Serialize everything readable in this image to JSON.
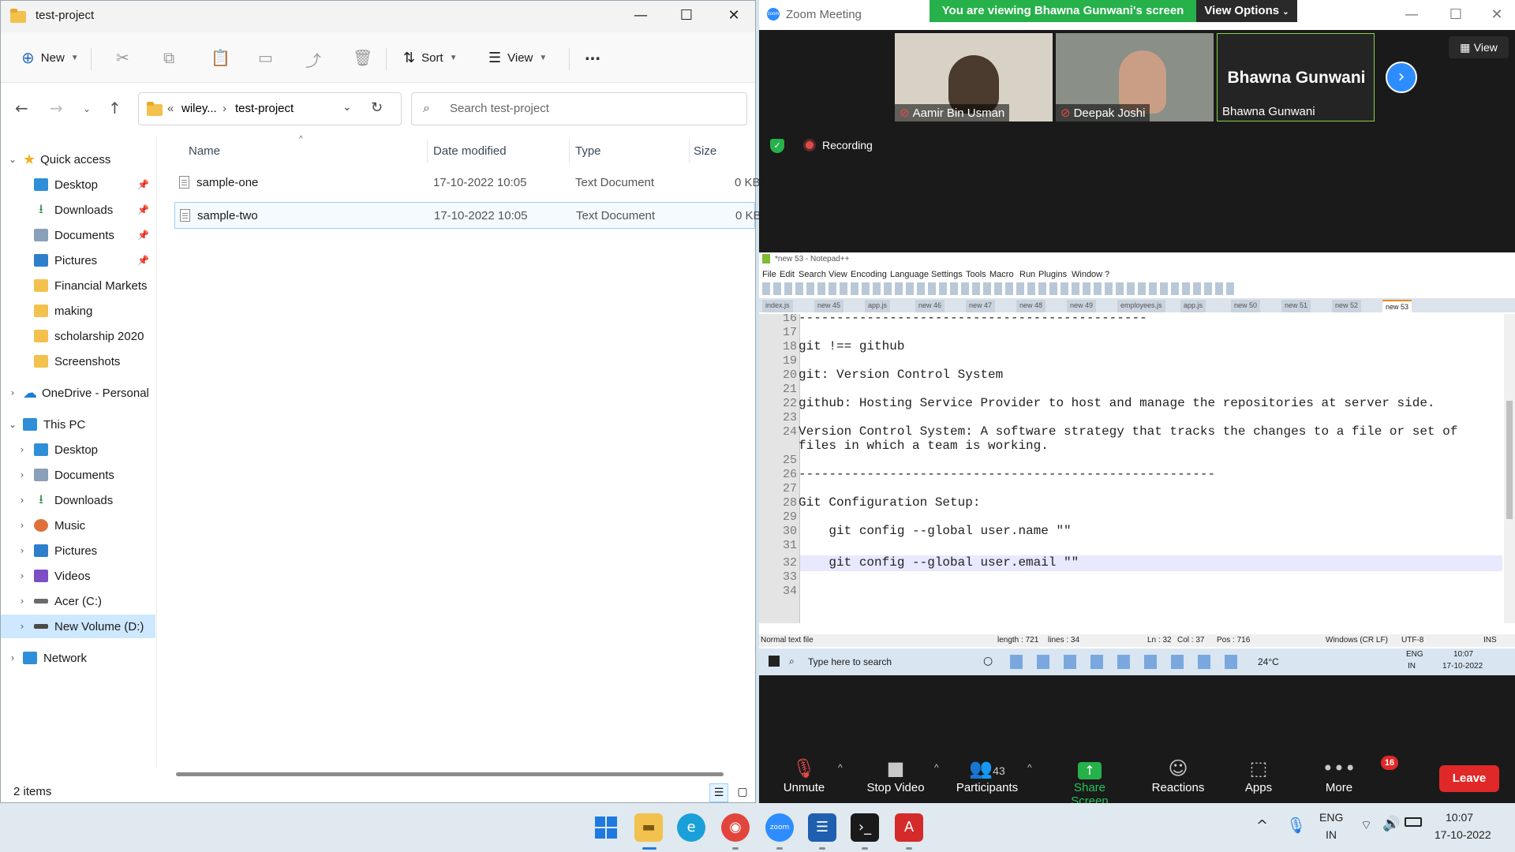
{
  "explorer": {
    "title": "test-project",
    "toolbar": {
      "new": "New",
      "sort": "Sort",
      "view": "View",
      "more": "..."
    },
    "address": {
      "prefix": "«",
      "parent": "wiley...",
      "sep": "›",
      "current": "test-project"
    },
    "search_placeholder": "Search test-project",
    "nav": {
      "quick_access": "Quick access",
      "quick_items": [
        "Desktop",
        "Downloads",
        "Documents",
        "Pictures",
        "Financial Markets",
        "making",
        "scholarship 2020",
        "Screenshots"
      ],
      "onedrive": "OneDrive - Personal",
      "this_pc": "This PC",
      "pc_items": [
        "Desktop",
        "Documents",
        "Downloads",
        "Music",
        "Pictures",
        "Videos",
        "Acer (C:)",
        "New Volume (D:)"
      ],
      "network": "Network"
    },
    "columns": {
      "name": "Name",
      "date": "Date modified",
      "type": "Type",
      "size": "Size"
    },
    "files": [
      {
        "name": "sample-one",
        "date": "17-10-2022 10:05",
        "type": "Text Document",
        "size": "0 KB"
      },
      {
        "name": "sample-two",
        "date": "17-10-2022 10:05",
        "type": "Text Document",
        "size": "0 KB"
      }
    ],
    "status": "2 items"
  },
  "zoom": {
    "title": "Zoom Meeting",
    "banner": "You are viewing Bhawna Gunwani's screen",
    "view_options": "View Options",
    "view_btn": "View",
    "participants": [
      {
        "name": "Aamir Bin Usman"
      },
      {
        "name": "Deepak Joshi"
      },
      {
        "name": "Bhawna Gunwani",
        "big": "Bhawna Gunwani"
      }
    ],
    "recording": "Recording",
    "controls": {
      "unmute": "Unmute",
      "stop_video": "Stop Video",
      "participants": "Participants",
      "participants_count": "43",
      "share": "Share Screen",
      "reactions": "Reactions",
      "apps": "Apps",
      "more": "More",
      "more_badge": "16",
      "leave": "Leave"
    }
  },
  "notepad": {
    "title": "*new 53 - Notepad++",
    "menu": [
      "File",
      "Edit",
      "Search",
      "View",
      "Encoding",
      "Language",
      "Settings",
      "Tools",
      "Macro",
      "Run",
      "Plugins",
      "Window",
      "?"
    ],
    "tabs": [
      "index.js",
      "new 45",
      "app.js",
      "new 46",
      "new 47",
      "new 48",
      "new 49",
      "employees.js",
      "app.js",
      "new 50",
      "new 51",
      "new 52",
      "new 53"
    ],
    "lines": [
      {
        "n": "16",
        "text": "----------------------------------------------"
      },
      {
        "n": "17",
        "text": ""
      },
      {
        "n": "18",
        "text": "git !== github"
      },
      {
        "n": "19",
        "text": ""
      },
      {
        "n": "20",
        "text": "git: Version Control System"
      },
      {
        "n": "21",
        "text": ""
      },
      {
        "n": "22",
        "text": "github: Hosting Service Provider to host and manage the repositories at server side."
      },
      {
        "n": "23",
        "text": ""
      },
      {
        "n": "24",
        "text": "Version Control System: A software strategy that tracks the changes to a file or set of"
      },
      {
        "n": "",
        "text": "files in which a team is working."
      },
      {
        "n": "25",
        "text": ""
      },
      {
        "n": "26",
        "text": "-------------------------------------------------------"
      },
      {
        "n": "27",
        "text": ""
      },
      {
        "n": "28",
        "text": "Git Configuration Setup:"
      },
      {
        "n": "29",
        "text": ""
      },
      {
        "n": "30",
        "text": "    git config --global user.name \"\""
      },
      {
        "n": "31",
        "text": ""
      },
      {
        "n": "32",
        "text": "    git config --global user.email \"\""
      },
      {
        "n": "33",
        "text": ""
      },
      {
        "n": "34",
        "text": ""
      }
    ],
    "status": {
      "filetype": "Normal text file",
      "length": "length : 721",
      "lines": "lines : 34",
      "ln": "Ln : 32",
      "col": "Col : 37",
      "pos": "Pos : 716",
      "eol": "Windows (CR LF)",
      "enc": "UTF-8",
      "mode": "INS"
    },
    "remote_taskbar": {
      "search": "Type here to search",
      "temp": "24°C",
      "lang1": "ENG",
      "lang2": "IN",
      "time": "10:07",
      "date": "17-10-2022"
    }
  },
  "taskbar": {
    "lang1": "ENG",
    "lang2": "IN",
    "time": "10:07",
    "date": "17-10-2022"
  }
}
